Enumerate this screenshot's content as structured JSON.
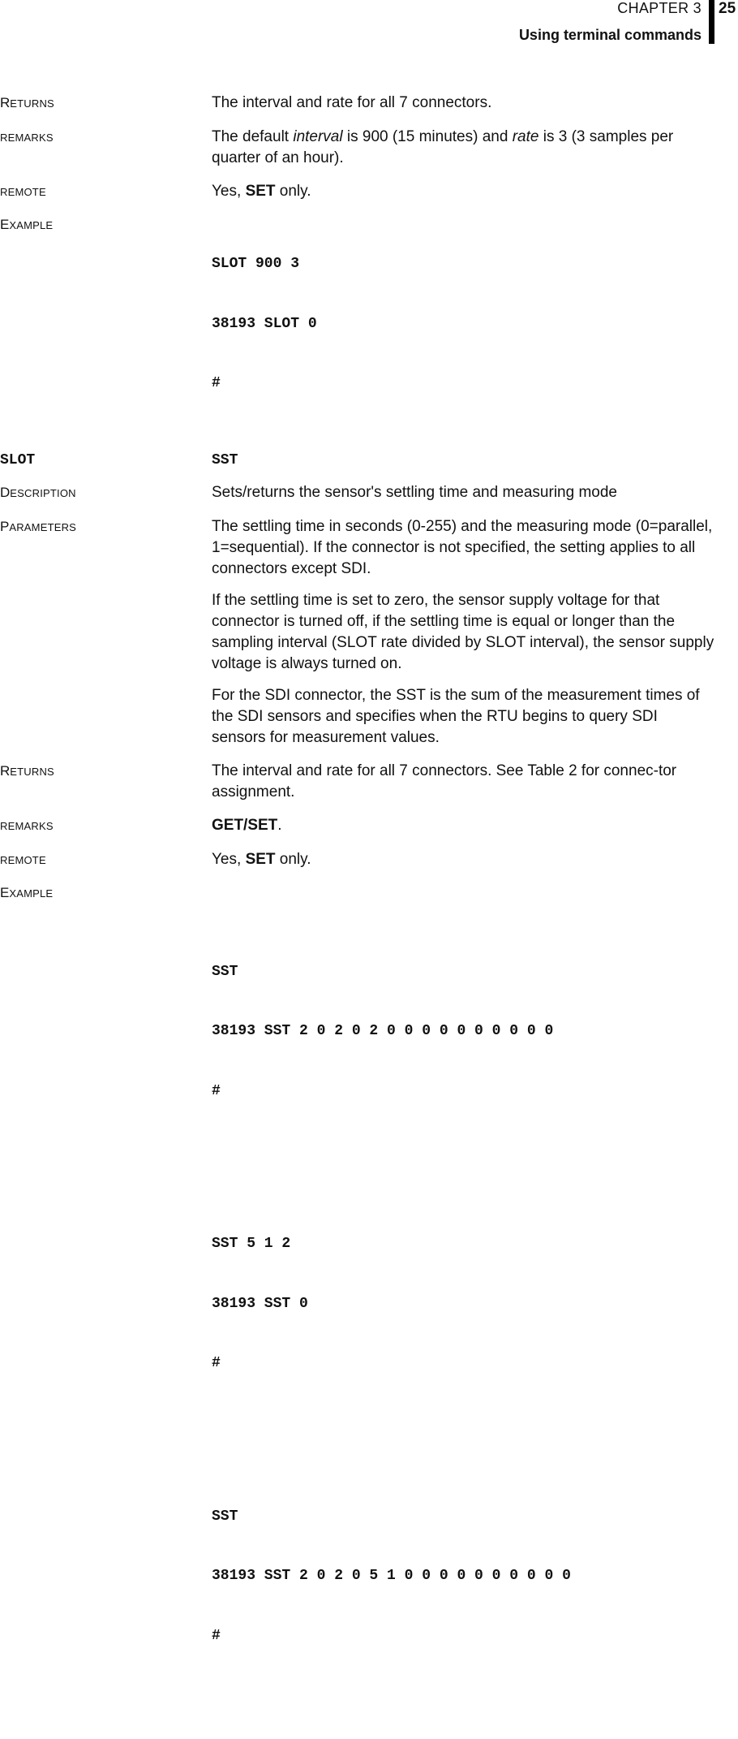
{
  "header": {
    "chapter": "CHAPTER 3",
    "title": "Using terminal commands",
    "page_number": "25"
  },
  "slot_section": {
    "returns": {
      "label_cap": "R",
      "label_rest": "ETURNS",
      "text": "The interval and rate for all 7 connectors."
    },
    "remarks": {
      "label": "REMARKS",
      "text_1": "The default ",
      "italic_1": "interval",
      "text_2": " is 900 (15 minutes) and ",
      "italic_2": "rate",
      "text_3": " is 3 (3 samples per quarter of an hour)."
    },
    "remote": {
      "label": "REMOTE",
      "text_1": "Yes, ",
      "bold": "SET",
      "text_2": " only."
    },
    "example": {
      "label_cap": "E",
      "label_rest": "XAMPLE",
      "lines": [
        "SLOT 900 3",
        "38193 SLOT 0",
        "#"
      ]
    }
  },
  "command_row": {
    "previous": "SLOT",
    "current": "SST"
  },
  "sst_section": {
    "description": {
      "label_cap": "D",
      "label_rest": "ESCRIPTION",
      "text": "Sets/returns the sensor's settling time and measuring mode"
    },
    "parameters": {
      "label_cap": "P",
      "label_rest": "ARAMETERS",
      "paragraphs": [
        "The settling time in seconds (0-255) and the measuring mode (0=parallel, 1=sequential). If the connector is not specified, the setting applies to all connectors except SDI.",
        "If the settling time is set to zero, the sensor supply voltage for that connector is turned off, if the settling time is equal or longer than the sampling interval (SLOT rate divided by SLOT interval), the sensor supply voltage is always turned on.",
        "For the SDI connector, the SST is the sum of the measurement times of the SDI sensors and specifies when the RTU begins to query SDI sensors for measurement values."
      ]
    },
    "returns": {
      "label_cap": "R",
      "label_rest": "ETURNS",
      "text": "The interval and rate for all 7 connectors. See Table 2 for connec-tor assignment."
    },
    "remarks": {
      "label": "REMARKS",
      "bold": "GET/SET",
      "text": "."
    },
    "remote": {
      "label": "REMOTE",
      "text_1": "Yes, ",
      "bold": "SET",
      "text_2": " only."
    },
    "example": {
      "label_cap": "E",
      "label_rest": "XAMPLE",
      "blocks": [
        [
          "SST",
          "38193 SST 2 0 2 0 2 0 0 0 0 0 0 0 0 0 0",
          "#"
        ],
        [
          "SST 5 1 2",
          "38193 SST 0",
          "#"
        ],
        [
          "SST",
          "38193 SST 2 0 2 0 5 1 0 0 0 0 0 0 0 0 0 0",
          "#"
        ]
      ]
    }
  }
}
